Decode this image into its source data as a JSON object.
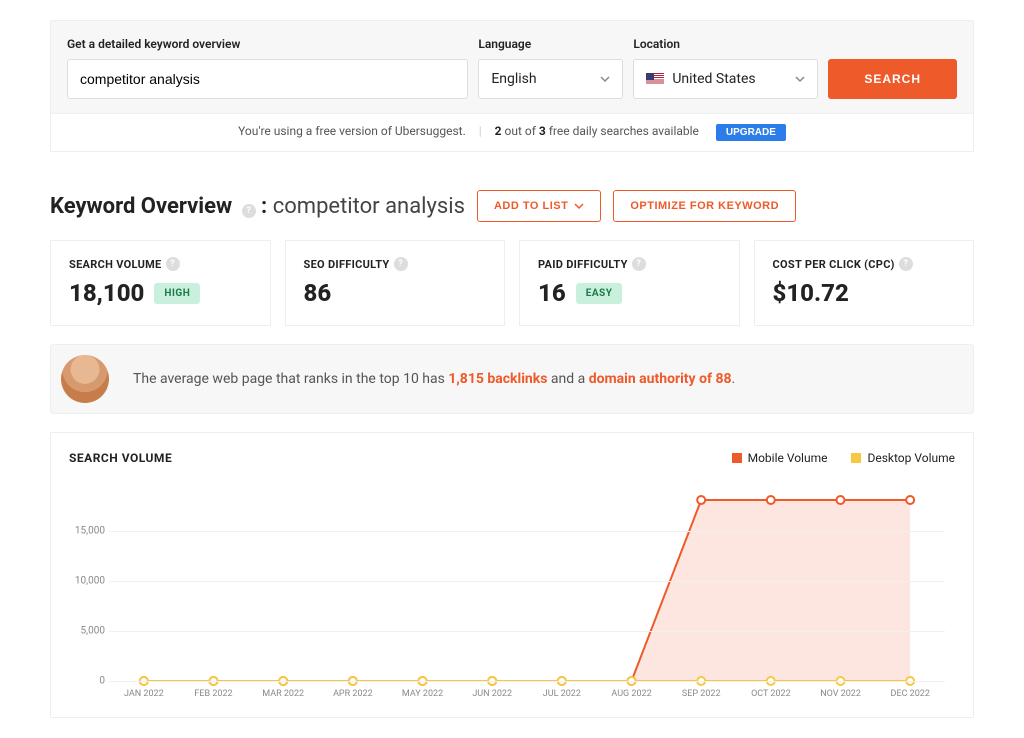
{
  "search": {
    "kw_label": "Get a detailed keyword overview",
    "kw_value": "competitor analysis",
    "lang_label": "Language",
    "lang_value": "English",
    "loc_label": "Location",
    "loc_value": "United States",
    "button": "SEARCH"
  },
  "notice": {
    "prefix": "You're using a free version of Ubersuggest.",
    "count": "2",
    "of": " out of ",
    "total": "3",
    "suffix": " free daily searches available",
    "upgrade": "UPGRADE"
  },
  "title": {
    "heading": "Keyword Overview",
    "sep": " : ",
    "keyword": "competitor analysis",
    "add": "ADD TO LIST",
    "optimize": "OPTIMIZE FOR KEYWORD"
  },
  "metrics": {
    "sv_label": "SEARCH VOLUME",
    "sv_value": "18,100",
    "sv_badge": "HIGH",
    "seo_label": "SEO DIFFICULTY",
    "seo_value": "86",
    "paid_label": "PAID DIFFICULTY",
    "paid_value": "16",
    "paid_badge": "EASY",
    "cpc_label": "COST PER CLICK (CPC)",
    "cpc_value": "$10.72"
  },
  "insight": {
    "p1": "The average web page that ranks in the top 10 has ",
    "b1": "1,815 backlinks",
    "p2": " and a ",
    "b2": "domain authority of 88",
    "p3": "."
  },
  "chart": {
    "title": "SEARCH VOLUME",
    "legend_mobile": "Mobile Volume",
    "legend_desktop": "Desktop Volume"
  },
  "chart_data": {
    "type": "area",
    "categories": [
      "JAN 2022",
      "FEB 2022",
      "MAR 2022",
      "APR 2022",
      "MAY 2022",
      "JUN 2022",
      "JUL 2022",
      "AUG 2022",
      "SEP 2022",
      "OCT 2022",
      "NOV 2022",
      "DEC 2022"
    ],
    "series": [
      {
        "name": "Mobile Volume",
        "color": "#ee5a29",
        "values": [
          0,
          0,
          0,
          0,
          0,
          0,
          0,
          0,
          18100,
          18100,
          18100,
          18100
        ]
      },
      {
        "name": "Desktop Volume",
        "color": "#f7c844",
        "values": [
          0,
          0,
          0,
          0,
          0,
          0,
          0,
          0,
          0,
          0,
          0,
          0
        ]
      }
    ],
    "ylabel": "",
    "xlabel": "",
    "ylim": [
      0,
      20000
    ],
    "yticks": [
      0,
      5000,
      10000,
      15000
    ]
  }
}
